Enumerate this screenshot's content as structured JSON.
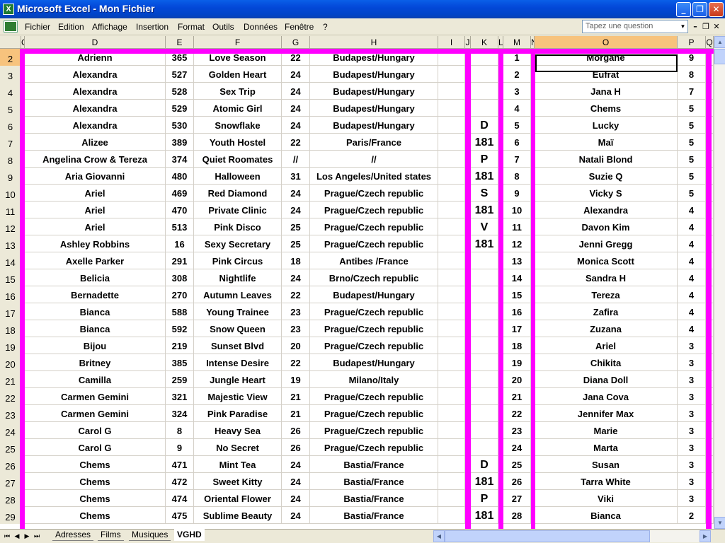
{
  "window": {
    "title": "Microsoft Excel - Mon Fichier",
    "app_icon": "X"
  },
  "menubar": {
    "items": [
      "Fichier",
      "Edition",
      "Affichage",
      "Insertion",
      "Format",
      "Outils",
      "Données",
      "Fenêtre",
      "?"
    ],
    "ask_placeholder": "Tapez une question"
  },
  "columns": {
    "D": "D",
    "E": "E",
    "F": "F",
    "G": "G",
    "H": "H",
    "I": "I",
    "J": "J",
    "K": "K",
    "L": "L",
    "M": "M",
    "N": "N",
    "O": "O",
    "P": "P",
    "Q": "Q",
    "C": "C"
  },
  "rows": [
    {
      "num": "2",
      "D": "Adrienn",
      "E": "365",
      "F": "Love Season",
      "G": "22",
      "H": "Budapest/Hungary",
      "K": "",
      "M": "1",
      "O": "Morgane",
      "P": "9"
    },
    {
      "num": "3",
      "D": "Alexandra",
      "E": "527",
      "F": "Golden Heart",
      "G": "24",
      "H": "Budapest/Hungary",
      "K": "",
      "M": "2",
      "O": "Eufrat",
      "P": "8"
    },
    {
      "num": "4",
      "D": "Alexandra",
      "E": "528",
      "F": "Sex Trip",
      "G": "24",
      "H": "Budapest/Hungary",
      "K": "",
      "M": "3",
      "O": "Jana H",
      "P": "7"
    },
    {
      "num": "5",
      "D": "Alexandra",
      "E": "529",
      "F": "Atomic Girl",
      "G": "24",
      "H": "Budapest/Hungary",
      "K": "",
      "M": "4",
      "O": "Chems",
      "P": "5"
    },
    {
      "num": "6",
      "D": "Alexandra",
      "E": "530",
      "F": "Snowflake",
      "G": "24",
      "H": "Budapest/Hungary",
      "K": "D",
      "M": "5",
      "O": "Lucky",
      "P": "5"
    },
    {
      "num": "7",
      "D": "Alizee",
      "E": "389",
      "F": "Youth Hostel",
      "G": "22",
      "H": "Paris/France",
      "K": "181",
      "M": "6",
      "O": "Maï",
      "P": "5"
    },
    {
      "num": "8",
      "D": "Angelina Crow & Tereza",
      "E": "374",
      "F": "Quiet Roomates",
      "G": "//",
      "H": "//",
      "K": "P",
      "M": "7",
      "O": "Natali Blond",
      "P": "5"
    },
    {
      "num": "9",
      "D": "Aria Giovanni",
      "E": "480",
      "F": "Halloween",
      "G": "31",
      "H": "Los Angeles/United states",
      "K": "181",
      "M": "8",
      "O": "Suzie Q",
      "P": "5"
    },
    {
      "num": "10",
      "D": "Ariel",
      "E": "469",
      "F": "Red Diamond",
      "G": "24",
      "H": "Prague/Czech republic",
      "K": "S",
      "M": "9",
      "O": "Vicky S",
      "P": "5"
    },
    {
      "num": "11",
      "D": "Ariel",
      "E": "470",
      "F": "Private Clinic",
      "G": "24",
      "H": "Prague/Czech republic",
      "K": "181",
      "M": "10",
      "O": "Alexandra",
      "P": "4"
    },
    {
      "num": "12",
      "D": "Ariel",
      "E": "513",
      "F": "Pink Disco",
      "G": "25",
      "H": "Prague/Czech republic",
      "K": "V",
      "M": "11",
      "O": "Davon Kim",
      "P": "4"
    },
    {
      "num": "13",
      "D": "Ashley Robbins",
      "E": "16",
      "F": "Sexy Secretary",
      "G": "25",
      "H": "Prague/Czech republic",
      "K": "181",
      "M": "12",
      "O": "Jenni Gregg",
      "P": "4"
    },
    {
      "num": "14",
      "D": "Axelle Parker",
      "E": "291",
      "F": "Pink Circus",
      "G": "18",
      "H": "Antibes /France",
      "K": "",
      "M": "13",
      "O": "Monica Scott",
      "P": "4"
    },
    {
      "num": "15",
      "D": "Belicia",
      "E": "308",
      "F": "Nightlife",
      "G": "24",
      "H": "Brno/Czech republic",
      "K": "",
      "M": "14",
      "O": "Sandra H",
      "P": "4"
    },
    {
      "num": "16",
      "D": "Bernadette",
      "E": "270",
      "F": "Autumn Leaves",
      "G": "22",
      "H": "Budapest/Hungary",
      "K": "",
      "M": "15",
      "O": "Tereza",
      "P": "4"
    },
    {
      "num": "17",
      "D": "Bianca",
      "E": "588",
      "F": "Young Trainee",
      "G": "23",
      "H": "Prague/Czech republic",
      "K": "",
      "M": "16",
      "O": "Zafira",
      "P": "4"
    },
    {
      "num": "18",
      "D": "Bianca",
      "E": "592",
      "F": "Snow Queen",
      "G": "23",
      "H": "Prague/Czech republic",
      "K": "",
      "M": "17",
      "O": "Zuzana",
      "P": "4"
    },
    {
      "num": "19",
      "D": "Bijou",
      "E": "219",
      "F": "Sunset Blvd",
      "G": "20",
      "H": "Prague/Czech republic",
      "K": "",
      "M": "18",
      "O": "Ariel",
      "P": "3"
    },
    {
      "num": "20",
      "D": "Britney",
      "E": "385",
      "F": "Intense Desire",
      "G": "22",
      "H": "Budapest/Hungary",
      "K": "",
      "M": "19",
      "O": "Chikita",
      "P": "3"
    },
    {
      "num": "21",
      "D": "Camilla",
      "E": "259",
      "F": "Jungle Heart",
      "G": "19",
      "H": "Milano/Italy",
      "K": "",
      "M": "20",
      "O": "Diana Doll",
      "P": "3"
    },
    {
      "num": "22",
      "D": "Carmen Gemini",
      "E": "321",
      "F": "Majestic View",
      "G": "21",
      "H": "Prague/Czech republic",
      "K": "",
      "M": "21",
      "O": "Jana Cova",
      "P": "3"
    },
    {
      "num": "23",
      "D": "Carmen Gemini",
      "E": "324",
      "F": "Pink Paradise",
      "G": "21",
      "H": "Prague/Czech republic",
      "K": "",
      "M": "22",
      "O": "Jennifer Max",
      "P": "3"
    },
    {
      "num": "24",
      "D": "Carol G",
      "E": "8",
      "F": "Heavy Sea",
      "G": "26",
      "H": "Prague/Czech republic",
      "K": "",
      "M": "23",
      "O": "Marie",
      "P": "3"
    },
    {
      "num": "25",
      "D": "Carol G",
      "E": "9",
      "F": "No Secret",
      "G": "26",
      "H": "Prague/Czech republic",
      "K": "",
      "M": "24",
      "O": "Marta",
      "P": "3"
    },
    {
      "num": "26",
      "D": "Chems",
      "E": "471",
      "F": "Mint Tea",
      "G": "24",
      "H": "Bastia/France",
      "K": "D",
      "M": "25",
      "O": "Susan",
      "P": "3"
    },
    {
      "num": "27",
      "D": "Chems",
      "E": "472",
      "F": "Sweet Kitty",
      "G": "24",
      "H": "Bastia/France",
      "K": "181",
      "M": "26",
      "O": "Tarra White",
      "P": "3"
    },
    {
      "num": "28",
      "D": "Chems",
      "E": "474",
      "F": "Oriental Flower",
      "G": "24",
      "H": "Bastia/France",
      "K": "P",
      "M": "27",
      "O": "Viki",
      "P": "3"
    },
    {
      "num": "29",
      "D": "Chems",
      "E": "475",
      "F": "Sublime Beauty",
      "G": "24",
      "H": "Bastia/France",
      "K": "181",
      "M": "28",
      "O": "Bianca",
      "P": "2"
    }
  ],
  "sheets": {
    "tabs": [
      "Adresses",
      "Films",
      "Musiques",
      "VGHD"
    ],
    "active": "VGHD"
  },
  "colors": {
    "highlight": "#ff00ff",
    "active_header": "#f7c37d",
    "titlebar": "#0348d8"
  }
}
